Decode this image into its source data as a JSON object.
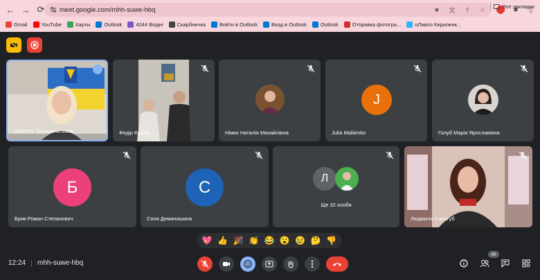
{
  "browser": {
    "url": "meet.google.com/mhh-suwe-hbq",
    "bookmarks": [
      {
        "label": "Gmail",
        "color": "#ea4335"
      },
      {
        "label": "YouTube",
        "color": "#ff0000"
      },
      {
        "label": "Карты",
        "color": "#34a853"
      },
      {
        "label": "Outlook",
        "color": "#0078d4"
      },
      {
        "label": "4244 Вхідні",
        "color": "#7e57c2"
      },
      {
        "label": "Скарбничка",
        "color": "#444444"
      },
      {
        "label": "Войти в Outlook",
        "color": "#0078d4"
      },
      {
        "label": "Вход в Outlook",
        "color": "#0078d4"
      },
      {
        "label": "Outlook",
        "color": "#0078d4"
      },
      {
        "label": "Отправка фотогра...",
        "color": "#d32f2f"
      },
      {
        "label": "uЛавло Кириленк...",
        "color": "#29b6f6"
      }
    ],
    "all_bookmarks": "Все закладки"
  },
  "participants": [
    {
      "name": "ОКІППО Тернопільський",
      "type": "video-flag"
    },
    {
      "name": "Федір Куціль",
      "type": "video-room"
    },
    {
      "name": "Німко Наталія Михайлівна",
      "type": "photo",
      "bg": "#7a5230"
    },
    {
      "name": "Julia Maliienko",
      "type": "letter",
      "letter": "J",
      "color": "#e8710a"
    },
    {
      "name": "Голуб Марія Ярославівна",
      "type": "photo",
      "bg": "#d9d4d0"
    },
    {
      "name": "Брик Роман Степанович",
      "type": "letter",
      "letter": "Б",
      "color": "#ec407a"
    },
    {
      "name": "Соня Демянишина",
      "type": "letter",
      "letter": "С",
      "color": "#1e63b5"
    },
    {
      "name": "Ще 32 особи",
      "type": "group",
      "letter": "Л",
      "color": "#5f6368"
    },
    {
      "name": "Людмила Салагуб",
      "type": "video-room2"
    }
  ],
  "reactions": [
    "💖",
    "👍",
    "🎉",
    "👏",
    "😂",
    "😮",
    "😢",
    "🤔",
    "👎"
  ],
  "footer": {
    "time": "12:24",
    "meeting_code": "mhh-suwe-hbq",
    "participant_count": "40"
  },
  "colors": {
    "accent": "#8ab4f8",
    "end": "#ea4335",
    "tile": "#3c4043"
  }
}
